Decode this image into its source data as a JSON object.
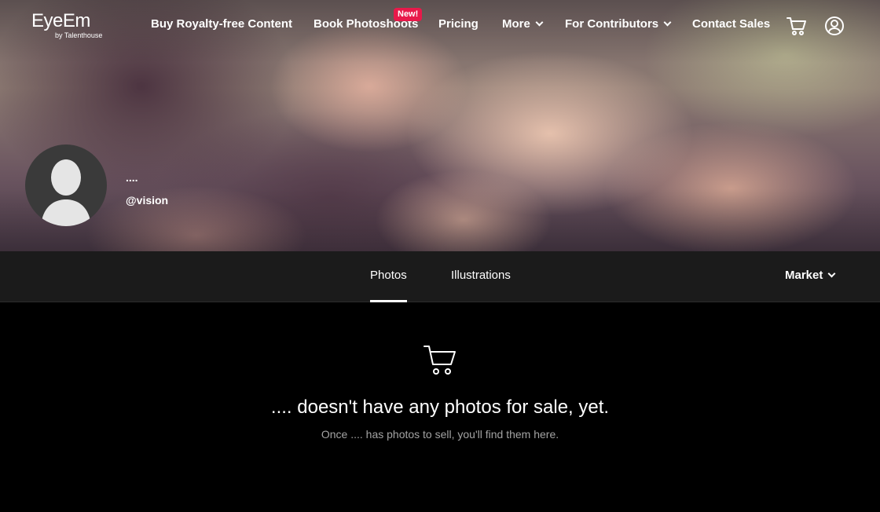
{
  "brand": {
    "name": "EyeEm",
    "tagline": "by Talenthouse"
  },
  "nav": {
    "buy": "Buy Royalty-free Content",
    "photoshoots": "Book Photoshoots",
    "new_badge": "New!",
    "pricing": "Pricing",
    "more": "More",
    "contributors": "For Contributors",
    "contact": "Contact Sales",
    "cart_icon": "cart-icon",
    "account_icon": "user-circle-icon"
  },
  "profile": {
    "name": "....",
    "handle": "@vision"
  },
  "tabs": [
    {
      "label": "Photos",
      "active": true
    },
    {
      "label": "Illustrations",
      "active": false
    }
  ],
  "market_filter": {
    "label": "Market"
  },
  "empty_state": {
    "icon": "cart-icon",
    "title": ".... doesn't have any photos for sale, yet.",
    "subtitle": "Once .... has photos to sell, you'll find them here."
  },
  "colors": {
    "badge": "#e8194a",
    "tabbar": "#1b1b1b",
    "background": "#000000",
    "muted_text": "#a3a3a3"
  }
}
